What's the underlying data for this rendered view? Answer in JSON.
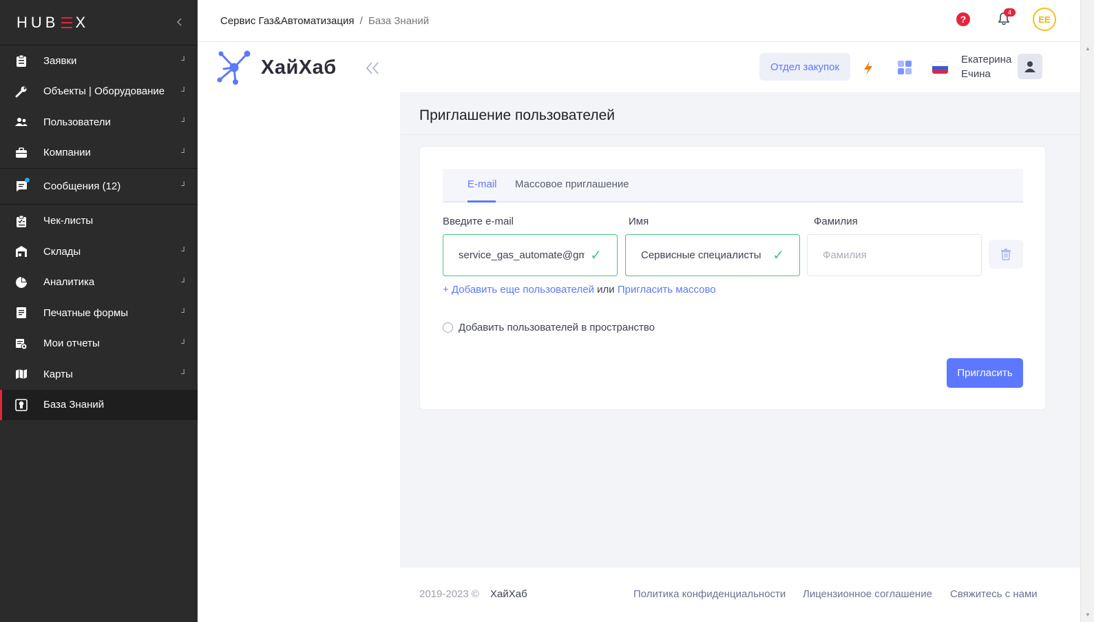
{
  "sidebar": {
    "logo": {
      "text_left": "HUB",
      "text_right": "X"
    },
    "collapse_icon": "chevron-left-icon",
    "groups": [
      [
        {
          "label": "Заявки",
          "icon": "clipboard-icon",
          "has_arrow": true
        },
        {
          "label": "Объекты | Оборудование",
          "icon": "wrench-icon",
          "has_arrow": true
        },
        {
          "label": "Пользователи",
          "icon": "users-icon",
          "has_arrow": true
        },
        {
          "label": "Компании",
          "icon": "briefcase-icon",
          "has_arrow": true
        }
      ],
      [
        {
          "label": "Сообщения (12)",
          "icon": "chat-icon",
          "has_arrow": true,
          "dot": true
        }
      ],
      [
        {
          "label": "Чек-листы",
          "icon": "checklist-icon",
          "has_arrow": false
        },
        {
          "label": "Склады",
          "icon": "warehouse-icon",
          "has_arrow": true
        },
        {
          "label": "Аналитика",
          "icon": "pie-chart-icon",
          "has_arrow": true
        },
        {
          "label": "Печатные формы",
          "icon": "document-icon",
          "has_arrow": true
        },
        {
          "label": "Мои отчеты",
          "icon": "report-icon",
          "has_arrow": true
        },
        {
          "label": "Карты",
          "icon": "map-icon",
          "has_arrow": true
        },
        {
          "label": "База Знаний",
          "icon": "knowledge-icon",
          "has_arrow": false,
          "active": true
        }
      ]
    ]
  },
  "topbar": {
    "breadcrumb_root": "Сервис Газ&Автоматизация",
    "breadcrumb_sep": "/",
    "breadcrumb_current": "База Знаний",
    "notification_count": "4",
    "avatar_initials": "EE"
  },
  "inner_sidebar": {
    "logo_text": "ХайХаб"
  },
  "header": {
    "department_button": "Отдел закупок",
    "user_first_name": "Екатерина",
    "user_last_name": "Ечина"
  },
  "page": {
    "title": "Приглашение пользователей",
    "tabs": [
      {
        "label": "E-mail",
        "active": true
      },
      {
        "label": "Массовое приглашение",
        "active": false
      }
    ],
    "fields": {
      "email_label": "Введите e-mail",
      "email_value": "service_gas_automate@gmai",
      "name_label": "Имя",
      "name_value": "Сервисные специалисты",
      "surname_label": "Фамилия",
      "surname_placeholder": "Фамилия"
    },
    "add_more_link": "+ Добавить еще пользователей",
    "or_text": "или",
    "mass_invite_link": "Пригласить массово",
    "space_checkbox_label": "Добавить пользователей в пространство",
    "invite_button": "Пригласить"
  },
  "footer": {
    "copyright": "2019-2023 ©",
    "brand": "ХайХаб",
    "links": [
      "Политика конфиденциальности",
      "Лицензионное соглашение",
      "Свяжитесь с нами"
    ]
  },
  "colors": {
    "sidebar_bg": "#2b2b2b",
    "accent_red": "#e3263c",
    "primary_blue": "#5d78ff",
    "valid_green": "#45c57c",
    "avatar_yellow": "#f4c020"
  }
}
